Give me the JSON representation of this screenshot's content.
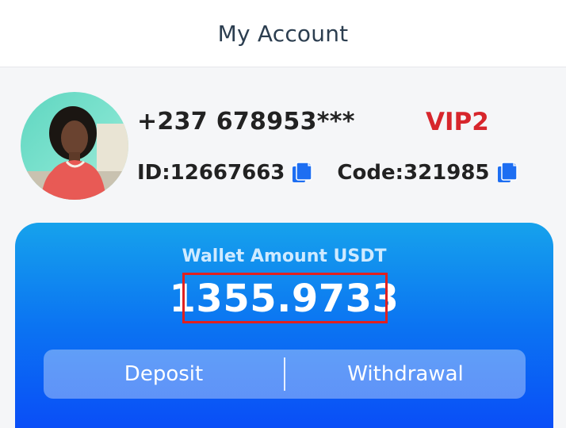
{
  "header": {
    "title": "My Account"
  },
  "profile": {
    "phone": "+237 678953***",
    "vip": "VIP2",
    "id_text": "ID:12667663",
    "code_text": "Code:321985"
  },
  "wallet": {
    "label": "Wallet Amount USDT",
    "amount": "1355.9733",
    "deposit_label": "Deposit",
    "withdrawal_label": "Withdrawal"
  },
  "colors": {
    "vip": "#d7262c",
    "wallet_top": "#16a2ec",
    "wallet_bottom": "#0a4ef7",
    "highlight": "#e02020"
  },
  "icons": {
    "avatar": "avatar-photo",
    "copy": "copy-icon"
  }
}
